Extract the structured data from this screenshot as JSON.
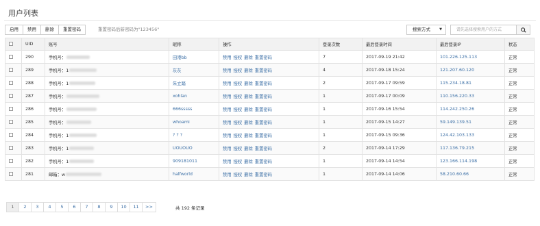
{
  "page": {
    "title": "用户列表"
  },
  "toolbar": {
    "buttons": [
      "启用",
      "禁用",
      "删除",
      "重置密码"
    ],
    "hint": "重置密码后新密码为\"123456\""
  },
  "search": {
    "select_label": "搜索方式",
    "placeholder": "请先选择搜索用户的方式"
  },
  "table": {
    "headers": [
      "UID",
      "账号",
      "昵称",
      "操作",
      "登录次数",
      "最后登录时间",
      "最后登录IP",
      "状态"
    ],
    "ops": [
      "禁用",
      "授权",
      "删除",
      "重置密码"
    ],
    "rows": [
      {
        "uid": "290",
        "account": "手机号：",
        "nickname": "田港bb",
        "logins": "7",
        "last_time": "2017-09-19 21:42",
        "last_ip": "101.226.125.113",
        "status": "正常"
      },
      {
        "uid": "289",
        "account": "手机号：1",
        "nickname": "灰灰",
        "logins": "4",
        "last_time": "2017-09-18 15:24",
        "last_ip": "121.207.60.120",
        "status": "正常"
      },
      {
        "uid": "288",
        "account": "手机号：1",
        "nickname": "朱立踏",
        "logins": "2",
        "last_time": "2017-09-17 09:59",
        "last_ip": "115.234.18.81",
        "status": "正常"
      },
      {
        "uid": "287",
        "account": "手机号：",
        "nickname": "xohlan",
        "logins": "1",
        "last_time": "2017-09-17 00:09",
        "last_ip": "110.156.220.33",
        "status": "正常"
      },
      {
        "uid": "286",
        "account": "手机号：",
        "nickname": "666sssss",
        "logins": "1",
        "last_time": "2017-09-16 15:54",
        "last_ip": "114.242.250.26",
        "status": "正常"
      },
      {
        "uid": "285",
        "account": "手机号：",
        "nickname": "whoami",
        "logins": "1",
        "last_time": "2017-09-15 14:27",
        "last_ip": "59.149.139.51",
        "status": "正常"
      },
      {
        "uid": "284",
        "account": "手机号：1",
        "nickname": "? ? ?",
        "logins": "1",
        "last_time": "2017-09-15 09:36",
        "last_ip": "124.42.103.133",
        "status": "正常"
      },
      {
        "uid": "283",
        "account": "手机号：1",
        "nickname": "UOUOUO",
        "logins": "2",
        "last_time": "2017-09-14 17:29",
        "last_ip": "117.136.79.215",
        "status": "正常"
      },
      {
        "uid": "282",
        "account": "手机号：1",
        "nickname": "909181011",
        "logins": "1",
        "last_time": "2017-09-14 14:54",
        "last_ip": "123.166.114.198",
        "status": "正常"
      },
      {
        "uid": "281",
        "account": "邮箱：w",
        "nickname": "halfworld",
        "logins": "1",
        "last_time": "2017-09-14 14:06",
        "last_ip": "58.210.60.66",
        "status": "正常"
      }
    ]
  },
  "pagination": {
    "pages": [
      "1",
      "2",
      "3",
      "4",
      "5",
      "6",
      "7",
      "8",
      "9",
      "10",
      "11",
      ">>"
    ],
    "active": "1",
    "total_text": "共 192 条记录"
  }
}
